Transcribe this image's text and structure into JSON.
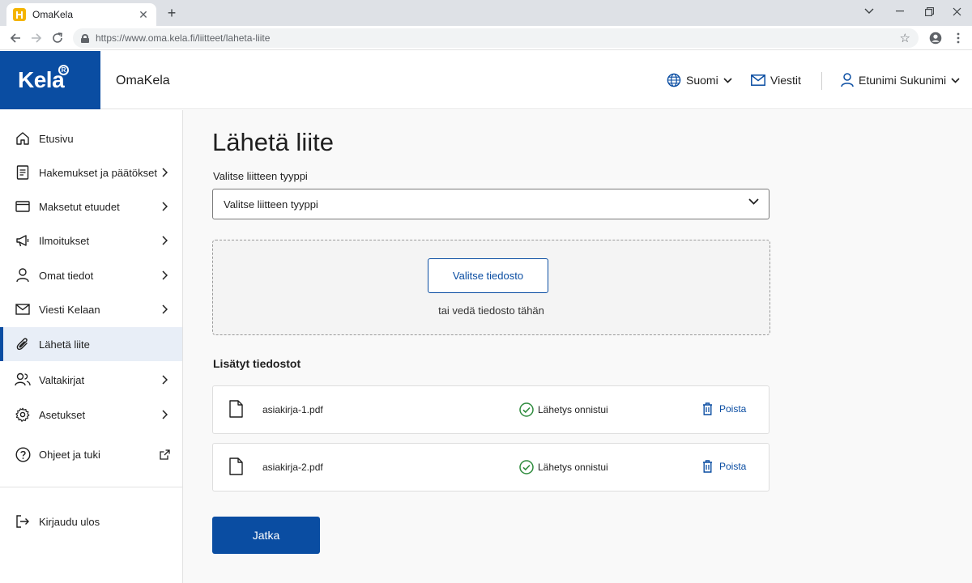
{
  "browser": {
    "tab_title": "OmaKela",
    "tab_close": "✕",
    "new_tab": "+",
    "url": "https://www.oma.kela.fi/liitteet/laheta-liite",
    "icons": [
      "back-icon",
      "forward-icon",
      "reload-icon",
      "lock-icon",
      "star-icon",
      "profile-icon",
      "menu-icon"
    ]
  },
  "header": {
    "logo_text": "Kela",
    "logo_mark": "R",
    "service_name": "OmaKela",
    "language_label": "Suomi",
    "messages_label": "Viestit",
    "user_name": "Etunimi Sukunimi"
  },
  "sidebar": {
    "items": [
      {
        "label": "Etusivu",
        "icon": "home-icon",
        "has_chevron": false
      },
      {
        "label": "Hakemukset ja päätökset",
        "icon": "document-icon",
        "has_chevron": true
      },
      {
        "label": "Maksetut etuudet",
        "icon": "card-icon",
        "has_chevron": true
      },
      {
        "label": "Ilmoitukset",
        "icon": "megaphone-icon",
        "has_chevron": true
      },
      {
        "label": "Omat tiedot",
        "icon": "user-icon",
        "has_chevron": true
      },
      {
        "label": "Viesti Kelaan",
        "icon": "mail-icon",
        "has_chevron": true
      },
      {
        "label": "Lähetä liite",
        "icon": "paperclip-icon",
        "has_chevron": false,
        "active": true
      },
      {
        "label": "Valtakirjat",
        "icon": "users-icon",
        "has_chevron": true
      },
      {
        "label": "Asetukset",
        "icon": "gear-icon",
        "has_chevron": true
      },
      {
        "label": "Ohjeet ja tuki",
        "icon": "help-icon",
        "has_chevron": false,
        "external": true
      }
    ],
    "logout_label": "Kirjaudu ulos"
  },
  "main": {
    "title": "Lähetä liite",
    "type_label": "Valitse liitteen tyyppi",
    "type_value": "Valitse liitteen tyyppi",
    "choose_file_label": "Valitse tiedosto",
    "drop_hint": "tai vedä tiedosto tähän",
    "files_title": "Lisätyt tiedostot",
    "files": [
      {
        "name": "asiakirja-1.pdf",
        "status": "Lähetys onnistui",
        "delete_label": "Poista"
      },
      {
        "name": "asiakirja-2.pdf",
        "status": "Lähetys onnistui",
        "delete_label": "Poista"
      }
    ],
    "continue_label": "Jatka"
  },
  "colors": {
    "brand_blue": "#0a4da2",
    "success_green": "#2e8b3d",
    "active_bg": "#e8eef7"
  }
}
